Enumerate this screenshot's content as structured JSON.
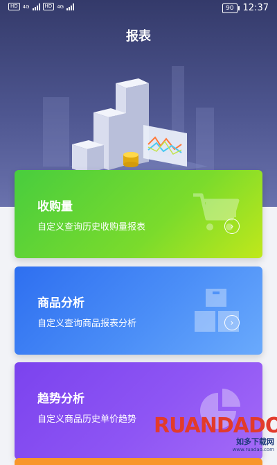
{
  "status_bar": {
    "sim_tags": [
      "HD",
      "HD"
    ],
    "network": [
      "4G",
      "4G"
    ],
    "battery": "90",
    "time": "12:37"
  },
  "header": {
    "title": "报表"
  },
  "cards": [
    {
      "title": "收购量",
      "subtitle": "自定义查询历史收购量报表",
      "icon": "cart-icon",
      "color": "#5bd236"
    },
    {
      "title": "商品分析",
      "subtitle": "自定义查询商品报表分析",
      "icon": "boxes-icon",
      "color": "#3b7cf3"
    },
    {
      "title": "趋势分析",
      "subtitle": "自定义商品历史单价趋势",
      "icon": "pie-chart-icon",
      "color": "#8a4ff2"
    }
  ],
  "watermark": {
    "logo": "RUANDADO",
    "cn": "如多下载网",
    "url": "www.ruadao.com"
  }
}
